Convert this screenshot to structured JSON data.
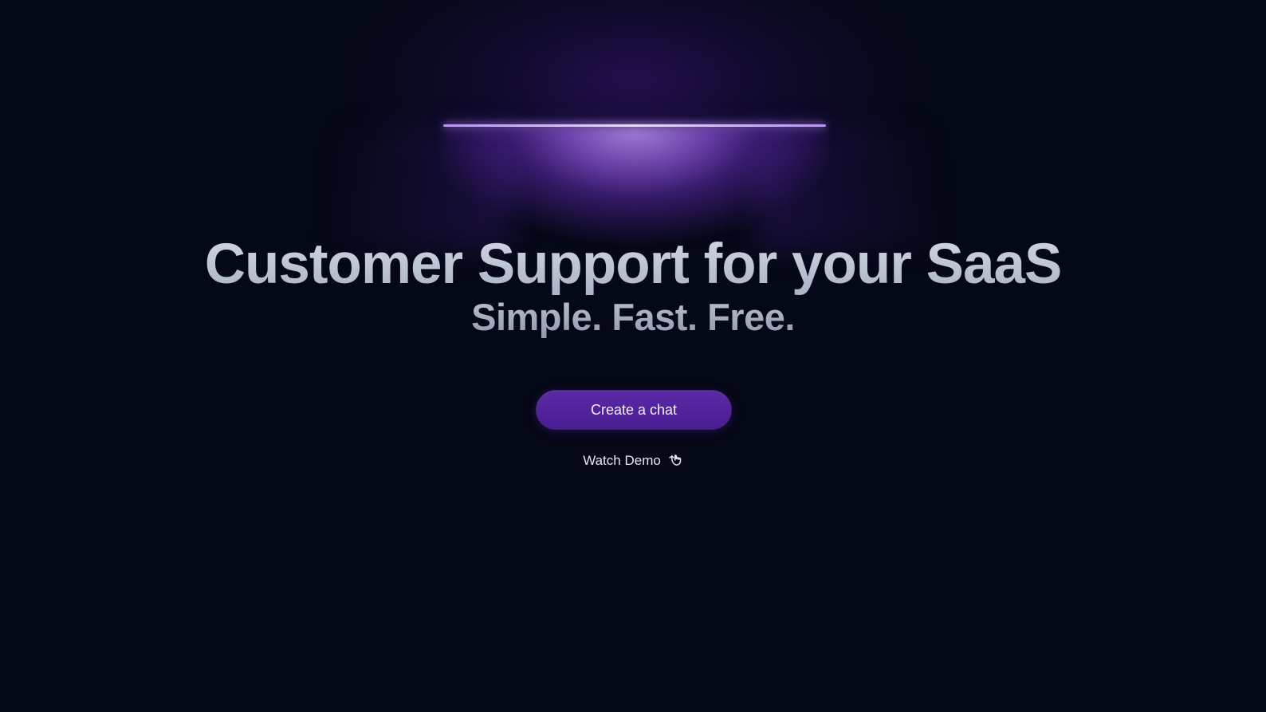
{
  "hero": {
    "headline": "Customer Support for your SaaS",
    "subheadline": "Simple. Fast. Free.",
    "primary_cta": "Create a chat",
    "secondary_cta": "Watch Demo",
    "secondary_cta_icon": "pointing-hand-icon"
  },
  "colors": {
    "background": "#050817",
    "accent": "#5a2aa6",
    "lamp": "#e7dbff",
    "headline": "#bcc4d4"
  }
}
